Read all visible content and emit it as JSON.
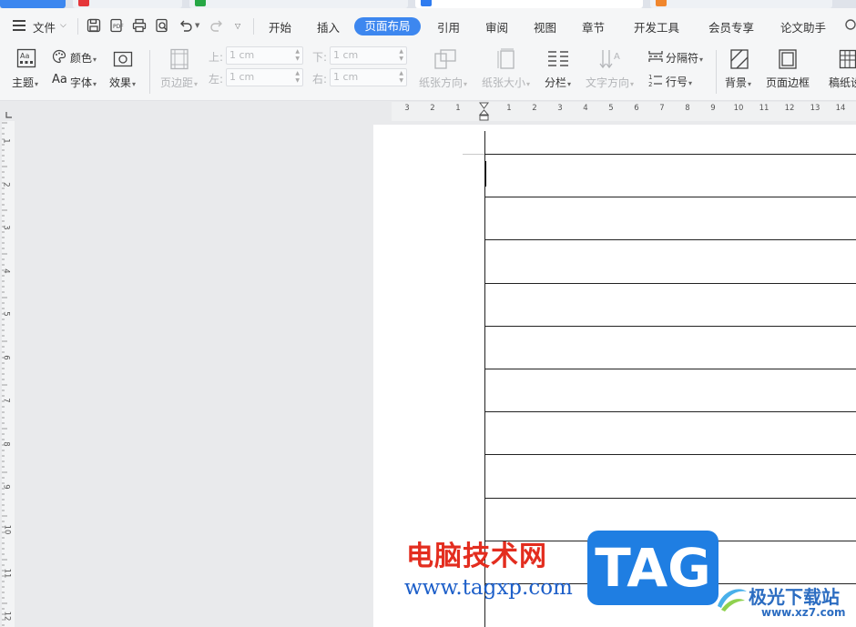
{
  "menu": {
    "file_label": "文件",
    "tabs": [
      "开始",
      "插入",
      "页面布局",
      "引用",
      "审阅",
      "视图",
      "章节",
      "开发工具",
      "会员专享",
      "论文助手"
    ],
    "active_tab": "页面布局"
  },
  "ribbon": {
    "theme": "主题",
    "color": "颜色",
    "font": "字体",
    "font_prefix": "Aa",
    "effect": "效果",
    "margins": "页边距",
    "top_label": "上:",
    "bottom_label": "下:",
    "left_label": "左:",
    "right_label": "右:",
    "top_value": "1 cm",
    "bottom_value": "1 cm",
    "left_value": "1 cm",
    "right_value": "1 cm",
    "orientation": "纸张方向",
    "size": "纸张大小",
    "columns": "分栏",
    "text_direction": "文字方向",
    "breaks": "分隔符",
    "line_numbers": "行号",
    "background": "背景",
    "page_border": "页面边框",
    "draft_paper": "稿纸设"
  },
  "ruler": {
    "h_left": [
      "3",
      "2",
      "1"
    ],
    "h_right": [
      "1",
      "2",
      "3",
      "4",
      "5",
      "6",
      "7",
      "8",
      "9",
      "10",
      "11",
      "12",
      "13",
      "14"
    ],
    "v": [
      "1",
      "2",
      "3",
      "4",
      "5",
      "6",
      "7",
      "8",
      "9",
      "10",
      "11",
      "12"
    ]
  },
  "watermark": {
    "site_cn": "电脑技术网",
    "site_url": "www.tagxp.com",
    "tag": "TAG",
    "brand_cn": "极光下载站",
    "brand_url": "www.xz7.com"
  },
  "colors": {
    "accent": "#3d87ef",
    "watermark_red": "#e32d1f",
    "watermark_blue": "#1f7ee2"
  }
}
